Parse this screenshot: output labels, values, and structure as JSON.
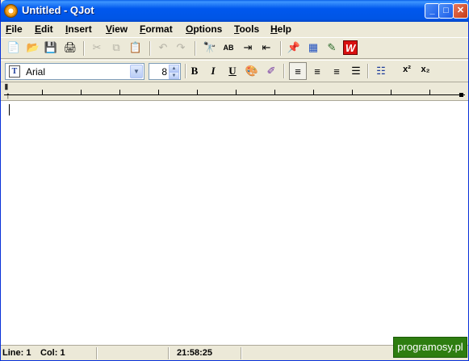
{
  "window": {
    "title": "Untitled - QJot"
  },
  "titlebar_buttons": {
    "minimize": "_",
    "maximize": "□",
    "close": "✕"
  },
  "menu": [
    "File",
    "Edit",
    "Insert",
    "View",
    "Format",
    "Options",
    "Tools",
    "Help"
  ],
  "toolbar": {
    "new_icon": "📄",
    "open_icon": "📂",
    "save_icon": "💾",
    "print_icon": "🖨",
    "cut_icon": "✂",
    "copy_icon": "⧉",
    "paste_icon": "📋",
    "undo_icon": "↶",
    "redo_icon": "↷",
    "find_icon": "🔭",
    "replace_icon": "AB",
    "indent_icon": "⇥",
    "outdent_icon": "⇤",
    "pin_icon": "📌",
    "calendar_icon": "▦",
    "wand_icon": "✎",
    "w_icon": "W"
  },
  "format_bar": {
    "font_name": "Arial",
    "font_size": "8",
    "bold": "B",
    "italic": "I",
    "underline": "U",
    "superscript": "x²",
    "subscript": "x₂"
  },
  "statusbar": {
    "line_label": "Line:",
    "line_value": "1",
    "col_label": "Col:",
    "col_value": "1",
    "time": "21:58:25"
  },
  "watermark": "programosy.pl"
}
